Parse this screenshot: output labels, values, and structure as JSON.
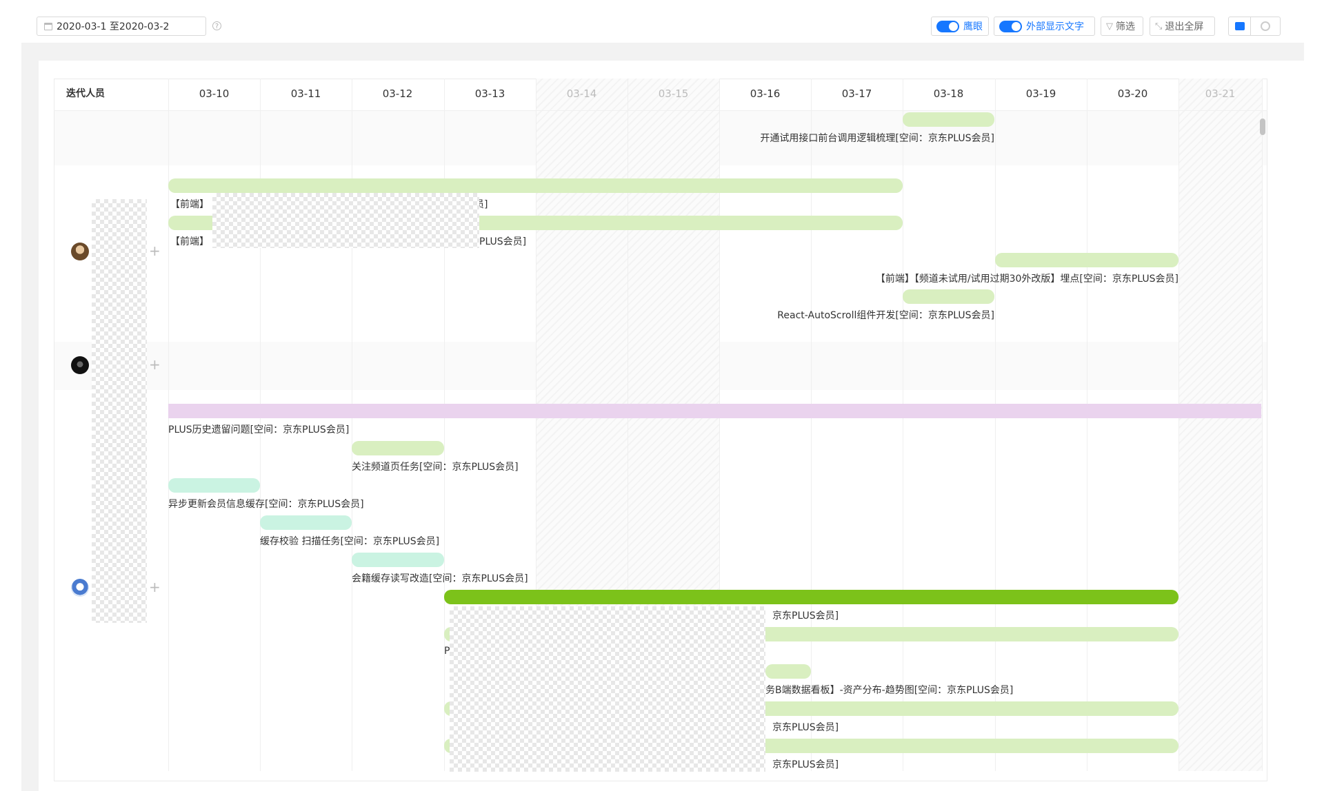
{
  "toolbar": {
    "date_range": "2020-03-1 至2020-03-2",
    "help_symbol": "?",
    "eagle_eye_label": "鹰眼",
    "outer_text_label": "外部显示文字",
    "filter_label": "筛选",
    "exit_fullscreen_label": "退出全屏",
    "filter_symbol": "▽",
    "exit_fullscreen_symbol": "⤡"
  },
  "header": {
    "person_column": "迭代人员",
    "dates": [
      "03-10",
      "03-11",
      "03-12",
      "03-13",
      "03-14",
      "03-15",
      "03-16",
      "03-17",
      "03-18",
      "03-19",
      "03-20",
      "03-21"
    ],
    "weekend_dates": [
      "03-14",
      "03-15",
      "03-21"
    ]
  },
  "rows": {
    "plus_symbol": "+"
  },
  "tasks": {
    "t1": "开通试用接口前台调用逻辑梳理[空间：京东PLUS会员]",
    "t2a": "【前端】",
    "t2b": "员]",
    "t3a": "【前端】",
    "t3b": "PLUS会员]",
    "t4": "【前端】【频道未试用/试用过期30外改版】埋点[空间：京东PLUS会员]",
    "t5": "React-AutoScroll组件开发[空间：京东PLUS会员]",
    "t6": "PLUS历史遗留问题[空间：京东PLUS会员]",
    "t7": "关注频道页任务[空间：京东PLUS会员]",
    "t8": "异步更新会员信息缓存[空间：京东PLUS会员]",
    "t9": "缓存校验 扫描任务[空间：京东PLUS会员]",
    "t10": "会籍缓存读写改造[空间：京东PLUS会员]",
    "t11": "京东PLUS会员]",
    "t12": "P",
    "t13": "务B端数据看板】-资产分布-趋势图[空间：京东PLUS会员]",
    "t14": "京东PLUS会员]",
    "t15": "京东PLUS会员]"
  },
  "colors": {
    "accent": "#1677ff",
    "bar_green": "#d9efc0",
    "bar_dark_green": "#7cc21a",
    "bar_teal": "#caf3e2",
    "bar_pink": "#ead3ee"
  }
}
